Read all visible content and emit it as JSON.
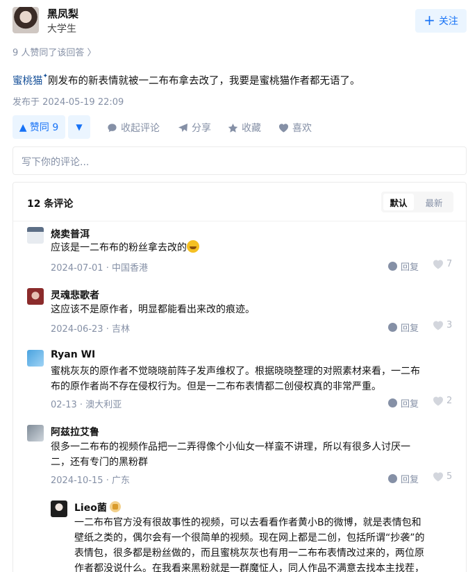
{
  "author": {
    "name": "黑凤梨",
    "bio": "大学生",
    "follow_label": "关注"
  },
  "answer": {
    "upvoters_text": "9 人赞同了该回答 〉",
    "tag": "蜜桃猫",
    "text": "刚发布的新表情就被一二布布拿去改了，我要是蜜桃猫作者都无语了。",
    "publish_time": "发布于 2024-05-19 22:09"
  },
  "actions": {
    "upvote_label": "▲ 赞同 9",
    "downvote_label": "▼",
    "collapse_comments": "收起评论",
    "share": "分享",
    "favorite": "收藏",
    "like": "喜欢"
  },
  "comment_input": {
    "placeholder": "写下你的评论..."
  },
  "comments_panel": {
    "count_label": "12 条评论",
    "sort_default": "默认",
    "sort_latest": "最新",
    "reply_label": "回复",
    "items": [
      {
        "name": "烧卖普洱",
        "text": "应该是一二布布的粉丝拿去改的",
        "date": "2024-07-01",
        "location": "中国香港",
        "likes": "7"
      },
      {
        "name": "灵魂悲歌者",
        "text": "这应该不是原作者，明显都能看出来改的痕迹。",
        "date": "2024-06-23",
        "location": "吉林",
        "likes": "3"
      },
      {
        "name": "Ryan WI",
        "text_line1": "蜜桃灰灰的原作者不觉晓晓前阵子发声维权了。根据晓晓整理的对照素材来看，一二布",
        "text_line2": "布的原作者尚不存在侵权行为。但是一二布布表情都二创侵权真的非常严重。",
        "date": "02-13",
        "location": "澳大利亚",
        "likes": "2"
      },
      {
        "name": "阿兹拉艾鲁",
        "text_line1": "很多一二布布的视频作品把一二弄得像个小仙女一样蛮不讲理，所以有很多人讨厌一",
        "text_line2": "二，还有专门的黑粉群",
        "date": "2024-10-15",
        "location": "广东",
        "likes": "5"
      }
    ],
    "reply": {
      "name": "Lieo菌",
      "text_line1": "一二布布官方没有很故事性的视频，可以去看看作者黄小B的微博，就是表情包和",
      "text_line2": "壁纸之类的，偶尔会有一个很简单的视频。现在网上都是二创，包括所谓“抄袭”的",
      "text_line3": "表情包，很多都是粉丝做的，而且蜜桃灰灰也有用一二布布表情改过来的，两位原",
      "text_line4": "作者都没说什么。在我看来黑粉就是一群魔怔人，同人作品不满意去找本主找茬，"
    }
  },
  "colors": {
    "accent": "#1772f6",
    "accent_bg": "#ebf5ff",
    "muted": "#8590a6",
    "link": "#175199"
  }
}
